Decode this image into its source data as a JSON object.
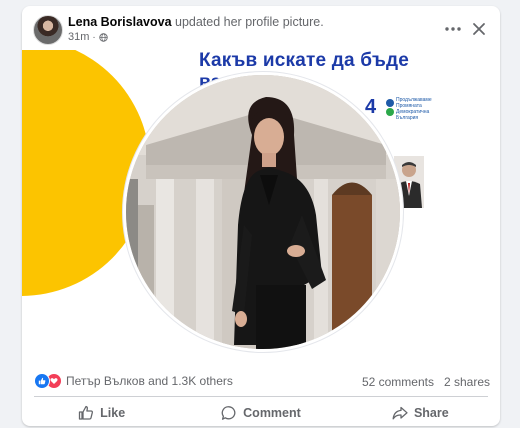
{
  "post": {
    "author": "Lena Borislavova",
    "action": "updated her profile picture.",
    "time": "31m",
    "separator": "·",
    "privacy_icon": "globe-icon"
  },
  "image": {
    "headline_line1": "Какъв искате да бъде",
    "headline_line2": "ва            емиер?",
    "party_number": "4",
    "party_name": "Продължаваме Промяната Демократична България"
  },
  "stats": {
    "reaction_icons": [
      "like-reaction-icon",
      "love-reaction-icon"
    ],
    "names": "Петър Вълков and 1.3K others",
    "comments": "52 comments",
    "shares": "2 shares"
  },
  "actions": {
    "like": "Like",
    "comment": "Comment",
    "share": "Share"
  },
  "colors": {
    "background": "#f0f2f5",
    "accent_yellow": "#fcc400",
    "headline_blue": "#1c3aa8",
    "like_blue": "#1877f2",
    "love_red": "#f33e58"
  }
}
